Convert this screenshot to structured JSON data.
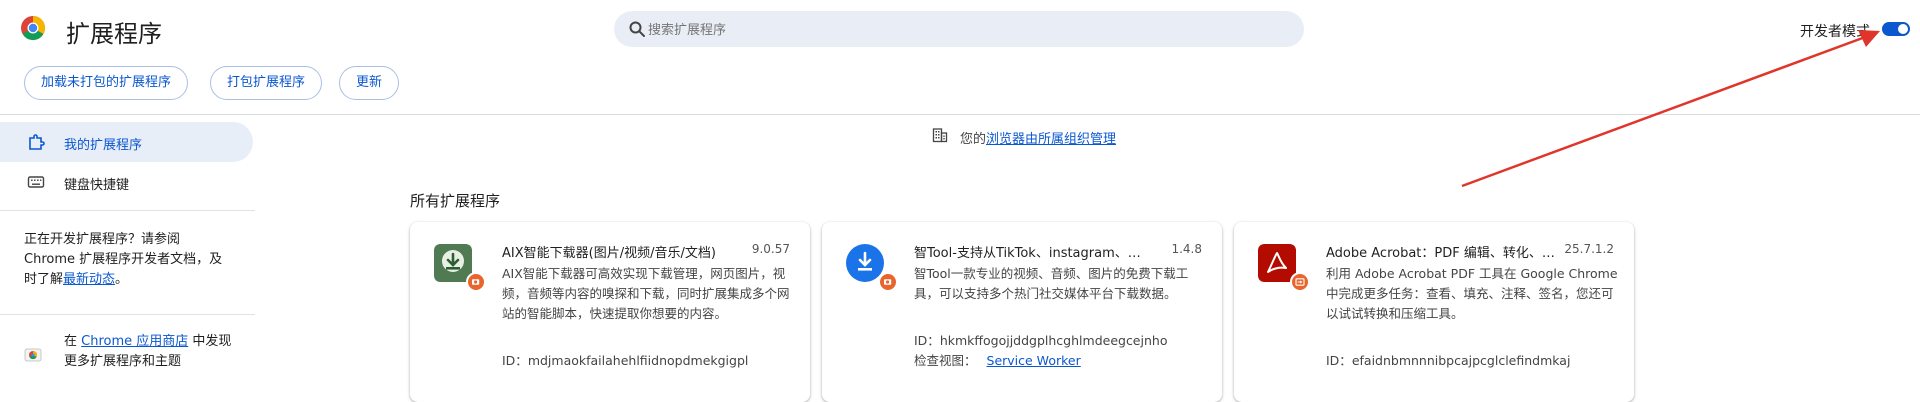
{
  "header": {
    "title": "扩展程序",
    "search_placeholder": "搜索扩展程序",
    "developer_mode_label": "开发者模式",
    "developer_mode_on": true
  },
  "toolbar": {
    "load_unpacked": "加载未打包的扩展程序",
    "pack": "打包扩展程序",
    "update": "更新"
  },
  "sidebar": {
    "items": [
      {
        "label": "我的扩展程序",
        "icon": "puzzle-icon",
        "active": true
      },
      {
        "label": "键盘快捷键",
        "icon": "keyboard-icon",
        "active": false
      }
    ],
    "dev_note_text": "正在开发扩展程序？请参阅 Chrome 扩展程序开发者文档，及时了解",
    "dev_note_link": "最新动态",
    "dev_note_end": "。",
    "store_prefix": "在",
    "store_link": "Chrome 应用商店",
    "store_suffix": "中发现更多扩展程序和主题"
  },
  "managed": {
    "prefix": "您的",
    "link": "浏览器由所属组织管理"
  },
  "section_title": "所有扩展程序",
  "cards": [
    {
      "name": "AIX智能下载器(图片/视频/音乐/文档)",
      "version": "9.0.57",
      "description": "AIX智能下载器可高效实现下载管理，网页图片，视频，音频等内容的嗅探和下载，同时扩展集成多个网站的智能脚本，快速提取你想要的内容。",
      "id_label": "ID：",
      "id": "mdjmaokfailahehlfiidnopdmekgigpl",
      "icon": "download-icon",
      "icon_color": "#5a8a5a"
    },
    {
      "name": "智Tool-支持从TikTok、instagram、twitter…",
      "version": "1.4.8",
      "description": "智Tool一款专业的视频、音频、图片的免费下载工具，可以支持多个热门社交媒体平台下载数据。",
      "id_label": "ID：",
      "id": "hkmkffogojjddgplhcghlmdeegcejnho",
      "inspect_label": "检查视图：",
      "inspect_link": "Service Worker",
      "icon": "download-icon",
      "icon_color": "#1a73e8"
    },
    {
      "name": "Adobe Acrobat：PDF 编辑、转化、签…",
      "version": "25.7.1.2",
      "description": "利用 Adobe Acrobat PDF 工具在 Google Chrome 中完成更多任务：查看、填充、注释、签名，您还可以试试转换和压缩工具。",
      "id_label": "ID：",
      "id": "efaidnbmnnnibpcajpcglclefindmkaj",
      "icon": "acrobat-icon",
      "icon_color": "#b30b00"
    }
  ],
  "colors": {
    "accent": "#0b57d0",
    "annotation_arrow": "#e0352b"
  }
}
